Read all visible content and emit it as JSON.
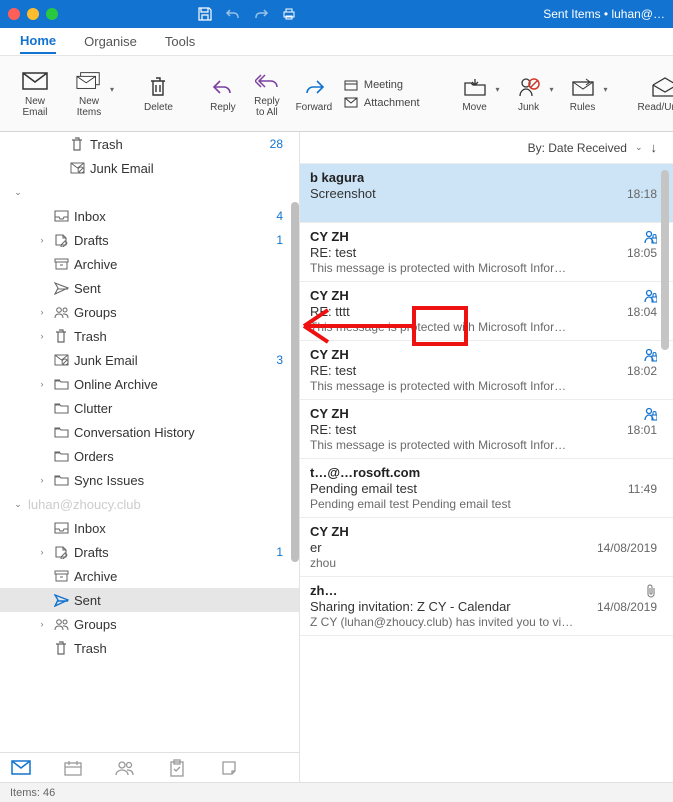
{
  "title_caption": "Sent Items • luhan@…",
  "tabs": {
    "home": "Home",
    "organise": "Organise",
    "tools": "Tools"
  },
  "ribbon": {
    "new_email": "New\nEmail",
    "new_items": "New\nItems",
    "delete": "Delete",
    "reply": "Reply",
    "reply_all": "Reply\nto All",
    "forward": "Forward",
    "meeting": "Meeting",
    "attachment": "Attachment",
    "move": "Move",
    "junk": "Junk",
    "rules": "Rules",
    "read": "Read/Unrea"
  },
  "folders": {
    "trash_top": {
      "name": "Trash",
      "count": "28"
    },
    "junk_top": {
      "name": "Junk Email"
    },
    "acct1_items": [
      {
        "name": "Inbox",
        "count": "4"
      },
      {
        "name": "Drafts",
        "count": "1",
        "chev": true
      },
      {
        "name": "Archive"
      },
      {
        "name": "Sent"
      },
      {
        "name": "Groups",
        "chev": true
      },
      {
        "name": "Trash",
        "chev": true
      },
      {
        "name": "Junk Email",
        "count": "3"
      },
      {
        "name": "Online Archive",
        "chev": true
      },
      {
        "name": "Clutter"
      },
      {
        "name": "Conversation History"
      },
      {
        "name": "Orders"
      },
      {
        "name": "Sync Issues",
        "chev": true
      }
    ],
    "acct2_label": "luhan@zhoucy.club",
    "acct2_items": [
      {
        "name": "Inbox"
      },
      {
        "name": "Drafts",
        "count": "1",
        "chev": true
      },
      {
        "name": "Archive"
      },
      {
        "name": "Sent",
        "selected": true
      },
      {
        "name": "Groups",
        "chev": true
      },
      {
        "name": "Trash"
      }
    ]
  },
  "msg_header": {
    "label": "By: Date Received"
  },
  "messages": [
    {
      "from": "b kagura",
      "subject": "Screenshot",
      "time": "18:18",
      "preview": "",
      "selected": true
    },
    {
      "from": "CY ZH",
      "subject": "RE: test",
      "time": "18:05",
      "preview": "This message is protected with Microsoft Infor…",
      "perm": true
    },
    {
      "from": "CY ZH",
      "subject": "RE: tttt",
      "time": "18:04",
      "preview": "This message is protected with Microsoft Infor…",
      "perm": true
    },
    {
      "from": "CY ZH",
      "subject": "RE: test",
      "time": "18:02",
      "preview": "This message is protected with Microsoft Infor…",
      "perm": true
    },
    {
      "from": "CY ZH",
      "subject": "RE: test",
      "time": "18:01",
      "preview": "This message is protected with Microsoft Infor…",
      "perm": true
    },
    {
      "from": "t…@…rosoft.com",
      "subject": "Pending email test",
      "time": "11:49",
      "preview": "Pending email test Pending email test"
    },
    {
      "from": "CY ZH",
      "subject": "er",
      "time": "14/08/2019",
      "preview": "zhou"
    },
    {
      "from": "zh…",
      "subject": "Sharing invitation: Z CY - Calendar",
      "time": "14/08/2019",
      "preview": "Z CY (luhan@zhoucy.club) has invited you to vi…",
      "attach": true
    }
  ],
  "status": "Items: 46"
}
